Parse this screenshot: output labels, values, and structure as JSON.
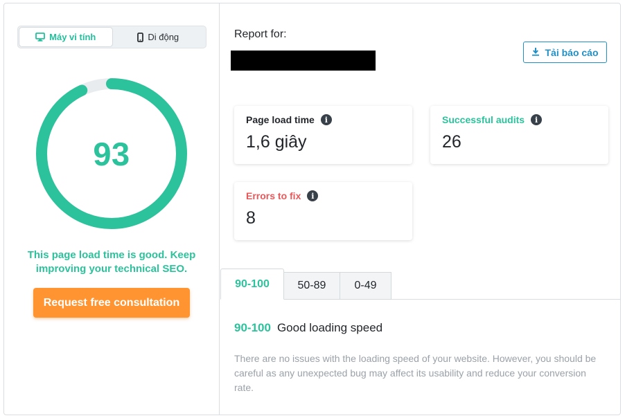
{
  "device_toggle": {
    "desktop_label": "Máy vi tính",
    "mobile_label": "Di động",
    "active": "desktop"
  },
  "score": {
    "value": "93",
    "fraction": 0.93,
    "color": "#2cc29b",
    "track_color": "#e8ecef"
  },
  "status_message": "This page load time is good. Keep improving your technical SEO.",
  "cta_label": "Request free consultation",
  "report": {
    "label": "Report for:",
    "download_label": "Tải báo cáo",
    "download_icon": "download-icon"
  },
  "metrics": {
    "page_load": {
      "label": "Page load time",
      "value": "1,6 giây"
    },
    "successful_audits": {
      "label": "Successful audits",
      "value": "26"
    },
    "errors": {
      "label": "Errors to fix",
      "value": "8"
    }
  },
  "tabs": [
    {
      "label": "90-100"
    },
    {
      "label": "50-89"
    },
    {
      "label": "0-49"
    }
  ],
  "active_tab": {
    "range": "90-100",
    "title": "Good loading speed",
    "description": "There are no issues with the loading speed of your website. However, you should be careful as any unexpected bug may affect its usability and reduce your conversion rate."
  },
  "colors": {
    "accent": "#2cc29b",
    "cta": "#ff9430",
    "link": "#1f8fc5",
    "error": "#e8585a"
  }
}
